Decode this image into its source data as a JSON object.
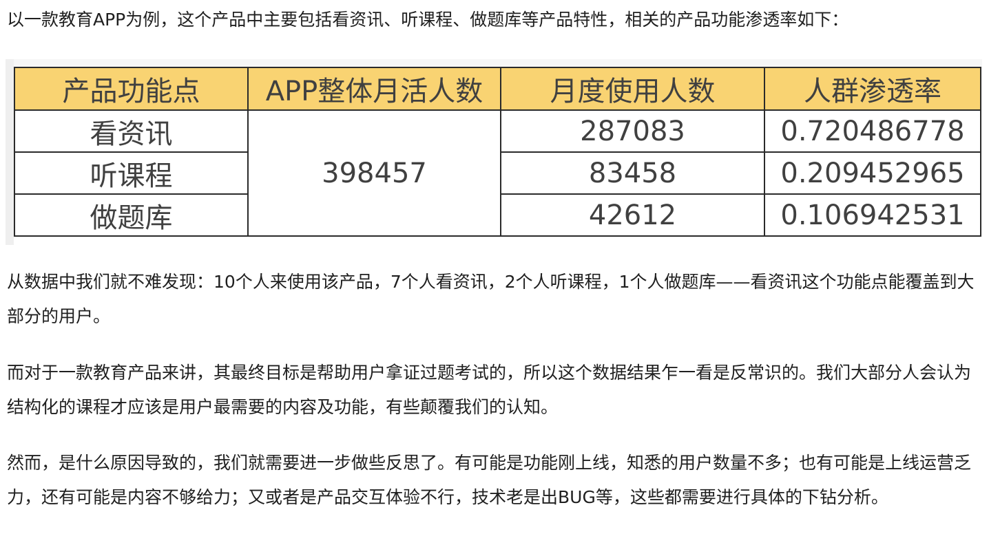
{
  "intro": "以一款教育APP为例，这个产品中主要包括看资讯、听课程、做题库等产品特性，相关的产品功能渗透率如下：",
  "table": {
    "headers": [
      "产品功能点",
      "APP整体月活人数",
      "月度使用人数",
      "人群渗透率"
    ],
    "monthly_active_users": "398457",
    "rows": [
      {
        "feature": "看资讯",
        "monthly_users": "287083",
        "penetration": "0.720486778"
      },
      {
        "feature": "听课程",
        "monthly_users": "83458",
        "penetration": "0.209452965"
      },
      {
        "feature": "做题库",
        "monthly_users": "42612",
        "penetration": "0.106942531"
      }
    ],
    "header_color": "#f9d372"
  },
  "paragraphs": {
    "finding": "从数据中我们就不难发现：10个人来使用该产品，7个人看资讯，2个人听课程，1个人做题库——看资讯这个功能点能覆盖到大部分的用户。",
    "education": "而对于一款教育产品来讲，其最终目标是帮助用户拿证过题考试的，所以这个数据结果乍一看是反常识的。我们大部分人会认为结构化的课程才应该是用户最需要的内容及功能，有些颠覆我们的认知。",
    "reflection": "然而，是什么原因导致的，我们就需要进一步做些反思了。有可能是功能刚上线，知悉的用户数量不多；也有可能是上线运营乏力，还有可能是内容不够给力；又或者是产品交互体验不行，技术老是出BUG等，这些都需要进行具体的下钻分析。"
  }
}
